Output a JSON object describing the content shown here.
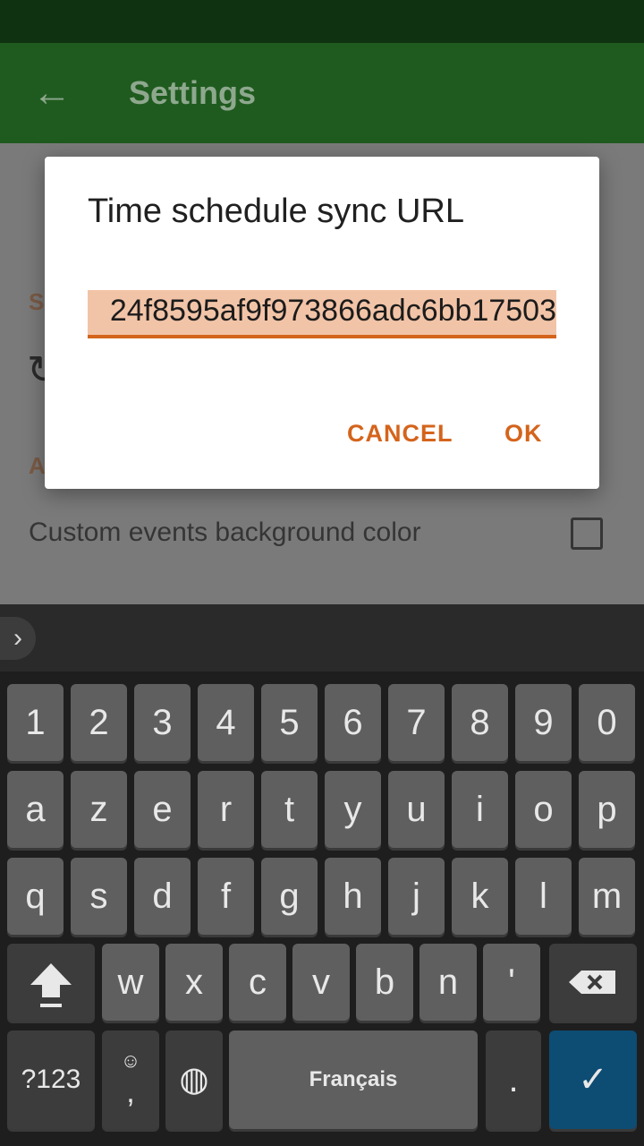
{
  "appbar": {
    "title": "Settings",
    "back_icon": "arrow-back-icon"
  },
  "settings": {
    "category_sync_letter": "S",
    "category_appearance_letter": "A",
    "custom_bg_label": "Custom events background color"
  },
  "dialog": {
    "title": "Time schedule sync URL",
    "field_value": "24f8595af9f973866adc6bb17503",
    "cancel_label": "CANCEL",
    "ok_label": "OK",
    "accent_color": "#d4641c"
  },
  "keyboard": {
    "row_numbers": [
      "1",
      "2",
      "3",
      "4",
      "5",
      "6",
      "7",
      "8",
      "9",
      "0"
    ],
    "row1": [
      "a",
      "z",
      "e",
      "r",
      "t",
      "y",
      "u",
      "i",
      "o",
      "p"
    ],
    "row2": [
      "q",
      "s",
      "d",
      "f",
      "g",
      "h",
      "j",
      "k",
      "l",
      "m"
    ],
    "row3": [
      "w",
      "x",
      "c",
      "v",
      "b",
      "n",
      "'"
    ],
    "symbols_label": "?123",
    "comma_label": ",",
    "space_label": "Français",
    "period_label": ".",
    "shift_icon": "shift-icon",
    "backspace_icon": "backspace-icon",
    "globe_icon": "globe-icon",
    "emoji_icon": "emoji-icon",
    "enter_icon": "check-icon",
    "expand_icon": "chevron-right-icon"
  }
}
